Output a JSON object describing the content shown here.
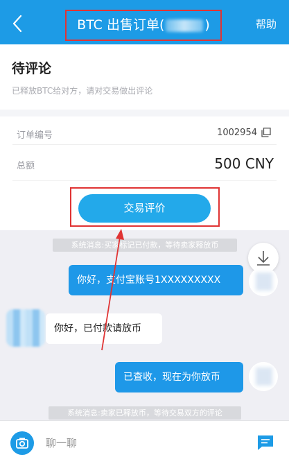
{
  "header": {
    "title_prefix": "BTC 出售订单(",
    "title_suffix": ")",
    "help_label": "帮助"
  },
  "status": {
    "title": "待评论",
    "description": "已释放BTC给对方，请对交易做出评论"
  },
  "order": {
    "number_label": "订单编号",
    "number_value": "1002954",
    "amount_label": "总额",
    "amount_value": "500 CNY"
  },
  "actions": {
    "rate_label": "交易评价"
  },
  "chat": {
    "system_messages": [
      "系统消息:买家标记已付款，等待卖家释放币",
      "系统消息:卖家已释放币，等待交易双方的评论"
    ],
    "messages": [
      {
        "side": "right",
        "text": "你好，支付宝账号1XXXXXXXXX"
      },
      {
        "side": "left",
        "text": "你好，已付款请放币"
      },
      {
        "side": "right",
        "text": "已查收，现在为你放币"
      }
    ],
    "input_placeholder": "聊一聊"
  },
  "colors": {
    "brand": "#1d9be6",
    "bubble": "#1e98e8",
    "highlight": "#e03434"
  }
}
